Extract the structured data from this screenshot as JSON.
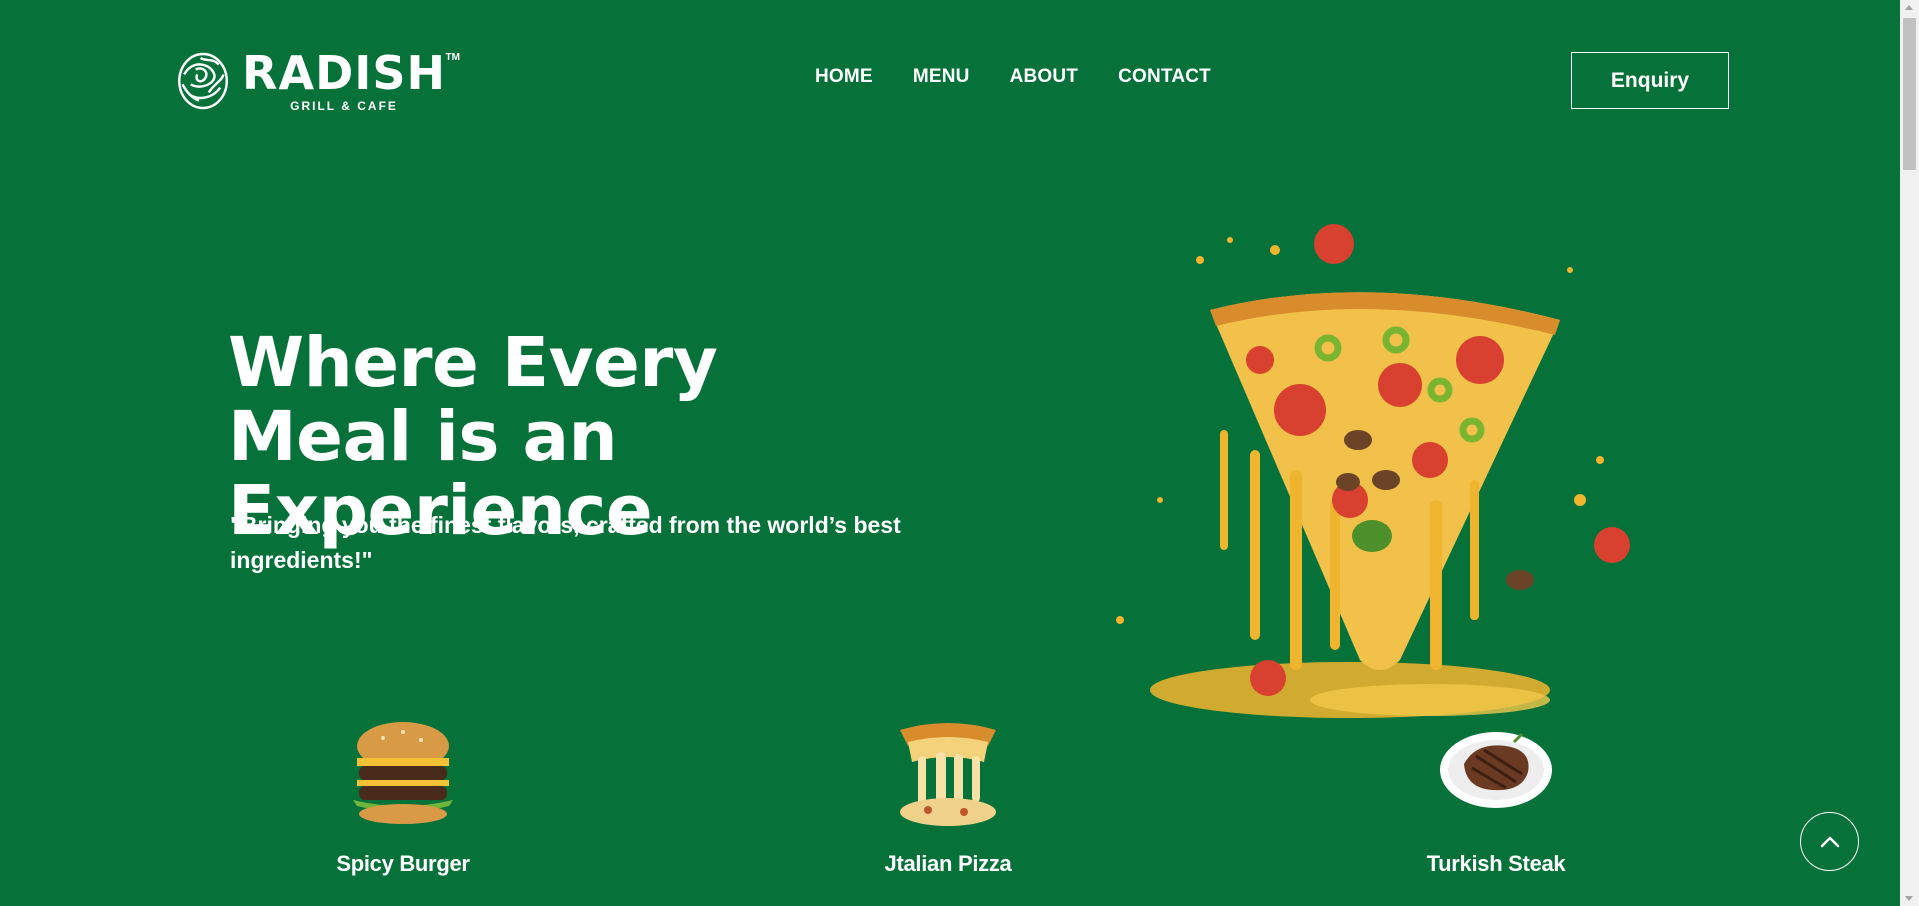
{
  "brand": {
    "name": "RADISH",
    "tm": "TM",
    "tagline": "GRILL & CAFE"
  },
  "nav": {
    "items": [
      "HOME",
      "MENU",
      "ABOUT",
      "CONTACT"
    ]
  },
  "header": {
    "enquiry_label": "Enquiry"
  },
  "hero": {
    "title_line1": "Where Every",
    "title_line2": "Meal is an Experience",
    "quote_line1": "\"Bringing you the finest flavors, crafted from the world’s best",
    "quote_line2": "ingredients!\"",
    "image_icon": "pizza-slice-image"
  },
  "features": [
    {
      "name": "Spicy Burger",
      "icon": "burger-image"
    },
    {
      "name": "Jtalian Pizza",
      "icon": "pizza-cheese-image"
    },
    {
      "name": "Turkish Steak",
      "icon": "steak-plate-image"
    }
  ],
  "colors": {
    "background": "#06723a",
    "text": "#ffffff"
  }
}
